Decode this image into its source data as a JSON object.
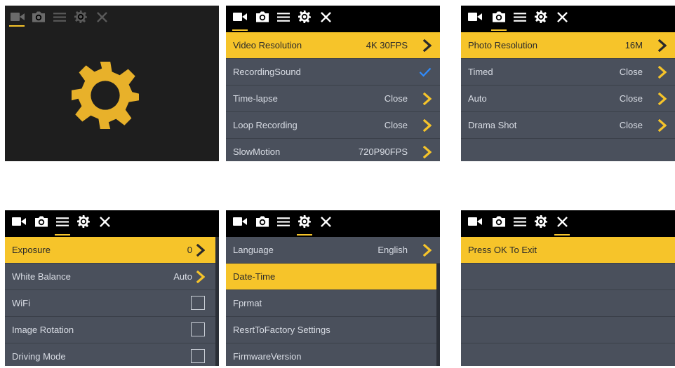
{
  "colors": {
    "accent": "#f6c42a",
    "panel": "#4a505c",
    "bar": "#000000",
    "check": "#2f8cff"
  },
  "screens": {
    "s1": {},
    "s2": {
      "rows": [
        {
          "label": "Video Resolution",
          "value": "4K 30FPS"
        },
        {
          "label": "RecordingSound",
          "value": ""
        },
        {
          "label": "Time-lapse",
          "value": "Close"
        },
        {
          "label": "Loop Recording",
          "value": "Close"
        },
        {
          "label": "SlowMotion",
          "value": "720P90FPS"
        }
      ]
    },
    "s3": {
      "rows": [
        {
          "label": "Photo Resolution",
          "value": "16M"
        },
        {
          "label": "Timed",
          "value": "Close"
        },
        {
          "label": "Auto",
          "value": "Close"
        },
        {
          "label": "Drama Shot",
          "value": "Close"
        }
      ]
    },
    "s4": {
      "rows": [
        {
          "label": "Exposure",
          "value": "0"
        },
        {
          "label": "White Balance",
          "value": "Auto"
        },
        {
          "label": "WiFi",
          "value": ""
        },
        {
          "label": "Image Rotation",
          "value": ""
        },
        {
          "label": "Driving Mode",
          "value": ""
        }
      ]
    },
    "s5": {
      "rows": [
        {
          "label": "Language",
          "value": "English"
        },
        {
          "label": "Date-Time",
          "value": ""
        },
        {
          "label": "Fprmat",
          "value": ""
        },
        {
          "label": "ResrtToFactory Settings",
          "value": ""
        },
        {
          "label": "FirmwareVersion",
          "value": ""
        }
      ]
    },
    "s6": {
      "rows": [
        {
          "label": "Press OK To Exit",
          "value": ""
        }
      ]
    }
  }
}
